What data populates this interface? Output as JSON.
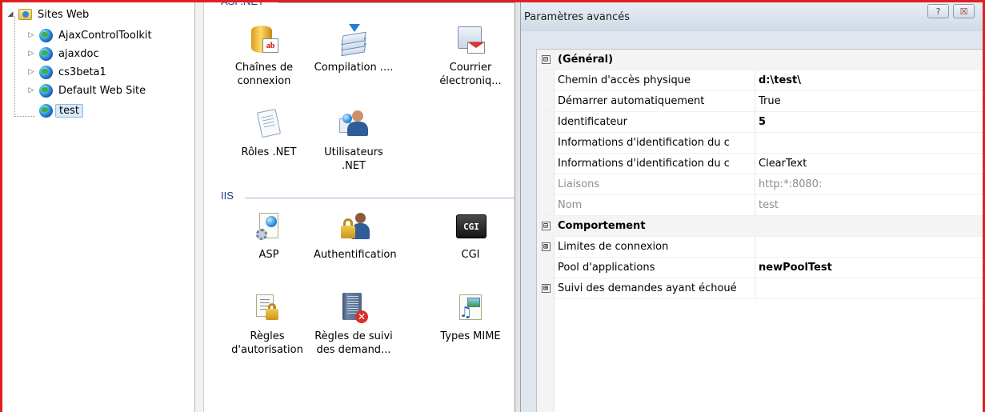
{
  "tree": {
    "root_label": "Sites Web",
    "sites": [
      {
        "label": "AjaxControlToolkit"
      },
      {
        "label": "ajaxdoc"
      },
      {
        "label": "cs3beta1"
      },
      {
        "label": "Default Web Site"
      },
      {
        "label": "test"
      }
    ],
    "selected": "test"
  },
  "features": {
    "groups": [
      {
        "header": "ASP.NET",
        "items": [
          {
            "label": "Chaînes de connexion",
            "icon": "connection-strings-icon"
          },
          {
            "label": "Compilation ....",
            "icon": "compilation-icon"
          },
          {
            "label": "Courrier électroniq...",
            "icon": "email-icon"
          },
          {
            "label": "Rôles .NET",
            "icon": "roles-icon"
          },
          {
            "label": "Utilisateurs .NET",
            "icon": "users-icon"
          }
        ]
      },
      {
        "header": "IIS",
        "items": [
          {
            "label": "ASP",
            "icon": "asp-icon"
          },
          {
            "label": "Authentification",
            "icon": "authentication-icon"
          },
          {
            "label": "CGI",
            "icon": "cgi-icon",
            "badge": "CGI"
          },
          {
            "label": "Règles d'autorisation",
            "icon": "authorization-rules-icon"
          },
          {
            "label": "Règles de suivi des demand...",
            "icon": "failed-request-tracing-icon"
          },
          {
            "label": "Types MIME",
            "icon": "mime-types-icon"
          }
        ]
      }
    ]
  },
  "dialog": {
    "title": "Paramètres avancés",
    "help_button": "?",
    "close_button": "☒",
    "rows": [
      {
        "type": "category",
        "name": "(Général)",
        "expander": "⊟"
      },
      {
        "type": "prop",
        "name": "Chemin d'accès physique",
        "value": "d:\\test\\",
        "bold": true
      },
      {
        "type": "prop",
        "name": "Démarrer automatiquement",
        "value": "True"
      },
      {
        "type": "prop",
        "name": "Identificateur",
        "value": "5",
        "bold": true
      },
      {
        "type": "prop",
        "name": "Informations d'identification du c",
        "value": ""
      },
      {
        "type": "prop",
        "name": "Informations d'identification du c",
        "value": "ClearText"
      },
      {
        "type": "readonly",
        "name": "Liaisons",
        "value": "http:*:8080:"
      },
      {
        "type": "readonly",
        "name": "Nom",
        "value": "test"
      },
      {
        "type": "category",
        "name": "Comportement",
        "expander": "⊟"
      },
      {
        "type": "expandable",
        "name": "Limites de connexion",
        "value": "",
        "expander": "⊞"
      },
      {
        "type": "prop",
        "name": "Pool d'applications",
        "value": "newPoolTest",
        "bold": true
      },
      {
        "type": "expandable",
        "name": "Suivi des demandes ayant échoué",
        "value": "",
        "expander": "⊞"
      }
    ]
  },
  "colors": {
    "highlight_frame": "#e02020",
    "selection": "#d9e8fa",
    "group_header": "#1e3a8a"
  }
}
